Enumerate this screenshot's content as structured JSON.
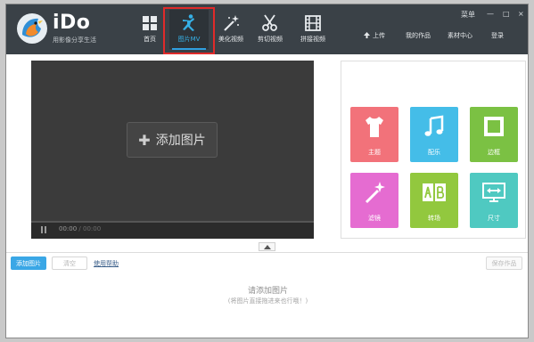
{
  "app": {
    "name": "iDo",
    "slogan": "用影像分享生活"
  },
  "nav": {
    "tabs": [
      {
        "label": "首页",
        "icon": "home-grid-icon",
        "active": false
      },
      {
        "label": "图片MV",
        "icon": "dancing-figure-icon",
        "active": true
      },
      {
        "label": "美化视频",
        "icon": "magic-wand-icon",
        "active": false
      },
      {
        "label": "剪切视频",
        "icon": "scissors-icon",
        "active": false
      },
      {
        "label": "拼接视频",
        "icon": "film-strip-icon",
        "active": false
      }
    ],
    "right": {
      "upload": "上传",
      "my_works": "我的作品",
      "materials": "素材中心",
      "login": "登录"
    },
    "window": {
      "menu": "菜单",
      "minimize": "—",
      "maximize": "□",
      "close": "×"
    }
  },
  "preview": {
    "add_button": "添加图片",
    "time_current": "00:00",
    "time_separator": " / ",
    "time_total": "00:00"
  },
  "effects": [
    {
      "label": "主题",
      "icon": "tshirt-icon",
      "color": "#f2727a"
    },
    {
      "label": "配乐",
      "icon": "music-note-icon",
      "color": "#44bde8"
    },
    {
      "label": "边框",
      "icon": "stamp-frame-icon",
      "color": "#7bc143"
    },
    {
      "label": "滤镜",
      "icon": "magic-wand-icon",
      "color": "#e56cd1"
    },
    {
      "label": "转场",
      "icon": "ab-transition-icon",
      "color": "#92c83e"
    },
    {
      "label": "尺寸",
      "icon": "resize-screen-icon",
      "color": "#4fc9c1"
    }
  ],
  "bottom": {
    "add_button": "添加图片",
    "clear_button": "清空",
    "help_link": "使用帮助",
    "save_button": "保存作品",
    "empty_title": "请添加图片",
    "empty_hint": "(将图片直接拖进来也行哦！)"
  }
}
